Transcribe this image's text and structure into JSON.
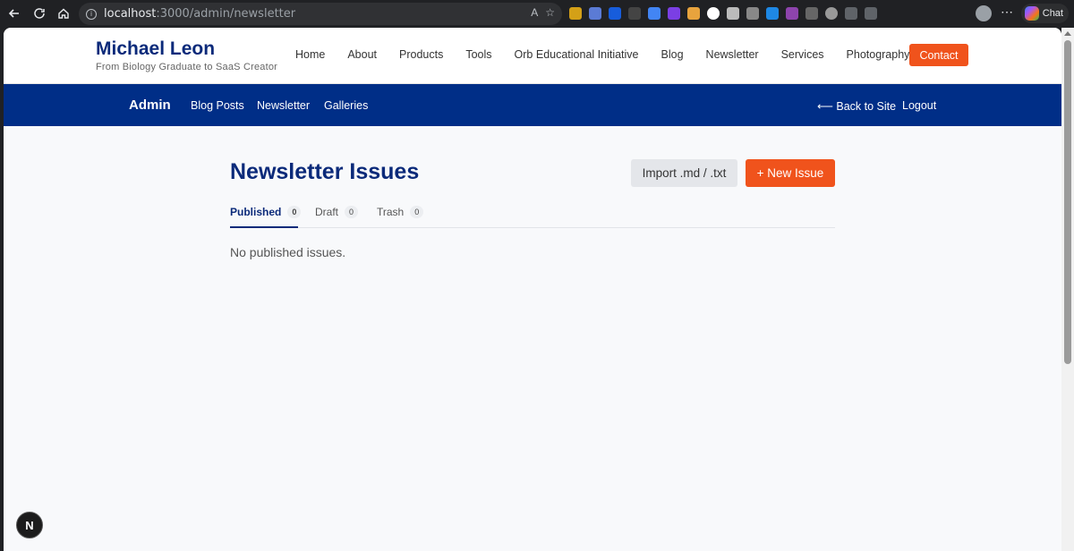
{
  "browser": {
    "url_host": "localhost",
    "url_path": ":3000/admin/newsletter",
    "chat_label": "Chat"
  },
  "site": {
    "brand_name": "Michael Leon",
    "brand_tagline": "From Biology Graduate to SaaS Creator",
    "nav": [
      "Home",
      "About",
      "Products",
      "Tools",
      "Orb Educational Initiative",
      "Blog",
      "Newsletter",
      "Services",
      "Photography"
    ],
    "contact_label": "Contact"
  },
  "admin": {
    "title": "Admin",
    "links": [
      "Blog Posts",
      "Newsletter",
      "Galleries"
    ],
    "back_label": "⟵ Back to Site",
    "logout_label": "Logout"
  },
  "main": {
    "title": "Newsletter Issues",
    "import_label": "Import .md / .txt",
    "new_label": "+ New Issue",
    "tabs": [
      {
        "label": "Published",
        "count": "0"
      },
      {
        "label": "Draft",
        "count": "0"
      },
      {
        "label": "Trash",
        "count": "0"
      }
    ],
    "empty_message": "No published issues."
  },
  "dev_badge": "N",
  "colors": {
    "brand_navy": "#0b2a7a",
    "admin_bar": "#002e87",
    "accent_orange": "#f0531c"
  }
}
